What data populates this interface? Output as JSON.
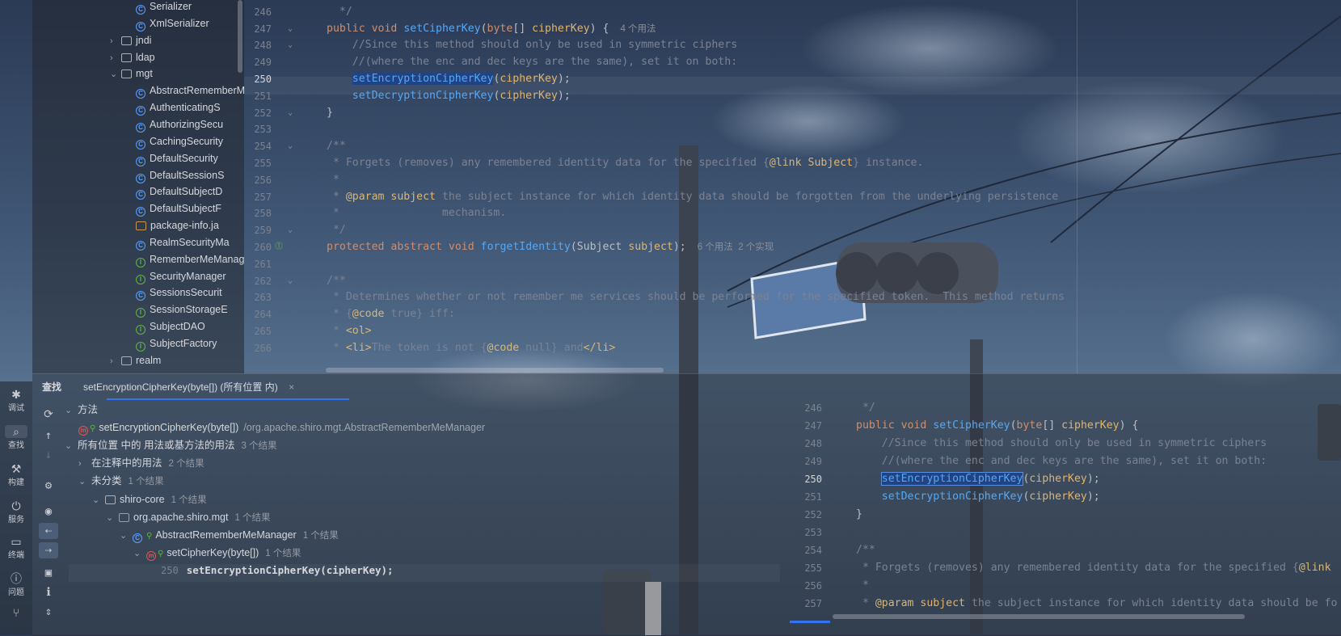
{
  "tree": {
    "items": [
      {
        "label": "Serializer",
        "kind": "class",
        "indent": 3
      },
      {
        "label": "XmlSerializer",
        "kind": "class",
        "indent": 3
      },
      {
        "label": "jndi",
        "kind": "package",
        "indent": 2,
        "chevron": "›"
      },
      {
        "label": "ldap",
        "kind": "package",
        "indent": 2,
        "chevron": "›"
      },
      {
        "label": "mgt",
        "kind": "package",
        "indent": 2,
        "chevron": "⌄"
      },
      {
        "label": "AbstractRememberMe",
        "kind": "class",
        "indent": 3
      },
      {
        "label": "AuthenticatingS",
        "kind": "class",
        "indent": 3
      },
      {
        "label": "AuthorizingSecu",
        "kind": "class",
        "indent": 3
      },
      {
        "label": "CachingSecurity",
        "kind": "class",
        "indent": 3
      },
      {
        "label": "DefaultSecurity",
        "kind": "class",
        "indent": 3
      },
      {
        "label": "DefaultSessionS",
        "kind": "class",
        "indent": 3
      },
      {
        "label": "DefaultSubjectD",
        "kind": "class",
        "indent": 3
      },
      {
        "label": "DefaultSubjectF",
        "kind": "class",
        "indent": 3
      },
      {
        "label": "package-info.ja",
        "kind": "file",
        "indent": 3
      },
      {
        "label": "RealmSecurityMa",
        "kind": "class",
        "indent": 3
      },
      {
        "label": "RememberMeManag",
        "kind": "interface",
        "indent": 3
      },
      {
        "label": "SecurityManager",
        "kind": "interface",
        "indent": 3
      },
      {
        "label": "SessionsSecurit",
        "kind": "class",
        "indent": 3
      },
      {
        "label": "SessionStorageE",
        "kind": "interface",
        "indent": 3
      },
      {
        "label": "SubjectDAO",
        "kind": "interface",
        "indent": 3
      },
      {
        "label": "SubjectFactory",
        "kind": "interface",
        "indent": 3
      },
      {
        "label": "realm",
        "kind": "package",
        "indent": 2,
        "chevron": "›"
      }
    ]
  },
  "editor": {
    "current_line": "250",
    "lines": [
      {
        "n": "",
        "text": "  */"
      },
      {
        "n": "246",
        "text": "  */"
      },
      {
        "n": "247",
        "text": "public void setCipherKey(byte[] cipherKey) {",
        "hint": "4 个用法"
      },
      {
        "n": "248",
        "text": "    //Since this method should only be used in symmetric ciphers"
      },
      {
        "n": "249",
        "text": "    //(where the enc and dec keys are the same), set it on both:"
      },
      {
        "n": "250",
        "text": "    setEncryptionCipherKey(cipherKey);"
      },
      {
        "n": "251",
        "text": "    setDecryptionCipherKey(cipherKey);"
      },
      {
        "n": "252",
        "text": "}"
      },
      {
        "n": "253",
        "text": ""
      },
      {
        "n": "254",
        "text": "/**"
      },
      {
        "n": "255",
        "text": " * Forgets (removes) any remembered identity data for the specified {@link Subject} instance."
      },
      {
        "n": "256",
        "text": " *"
      },
      {
        "n": "257",
        "text": " * @param subject the subject instance for which identity data should be forgotten from the underlying persistence"
      },
      {
        "n": "258",
        "text": " *                mechanism."
      },
      {
        "n": "259",
        "text": " */"
      },
      {
        "n": "260",
        "text": "protected abstract void forgetIdentity(Subject subject);",
        "hint": "6 个用法  2 个实现"
      },
      {
        "n": "261",
        "text": ""
      },
      {
        "n": "262",
        "text": "/**"
      },
      {
        "n": "263",
        "text": " * Determines whether or not remember me services should be performed for the specified token.  This method returns"
      },
      {
        "n": "264",
        "text": " * {@code true} iff:"
      },
      {
        "n": "265",
        "text": " * <ol>"
      },
      {
        "n": "266",
        "text": " * <li>The token is not {@code null} and</li>"
      }
    ]
  },
  "sidebar": {
    "items": [
      {
        "label": "调试",
        "icon": "debug-icon",
        "glyph": "✱"
      },
      {
        "label": "查找",
        "icon": "find-icon",
        "glyph": "⌕",
        "active": true
      },
      {
        "label": "构建",
        "icon": "build-icon",
        "glyph": "⚒"
      },
      {
        "label": "服务",
        "icon": "services-icon",
        "glyph": "⏻"
      },
      {
        "label": "终端",
        "icon": "terminal-icon",
        "glyph": "▭"
      },
      {
        "label": "问题",
        "icon": "problems-icon",
        "glyph": "ⓘ"
      },
      {
        "label": "",
        "icon": "git-icon",
        "glyph": "⑂"
      }
    ]
  },
  "find_panel": {
    "title": "查找",
    "tab_label": "setEncryptionCipherKey(byte[]) (所有位置 内)",
    "close": "×",
    "tree": [
      {
        "label": "方法",
        "indent": 0,
        "chevron": "⌄"
      },
      {
        "label": "setEncryptionCipherKey(byte[])",
        "suffix": "/org.apache.shiro.mgt.AbstractRememberMeManager",
        "indent": 1,
        "icon": "method"
      },
      {
        "label": "所有位置 中的 用法或基方法的用法",
        "count": "3 个结果",
        "indent": 0,
        "chevron": "⌄"
      },
      {
        "label": "在注释中的用法",
        "count": "2 个结果",
        "indent": 1,
        "chevron": "›"
      },
      {
        "label": "未分类",
        "count": "1 个结果",
        "indent": 1,
        "chevron": "⌄"
      },
      {
        "label": "shiro-core",
        "count": "1 个结果",
        "indent": 2,
        "chevron": "⌄",
        "icon": "module"
      },
      {
        "label": "org.apache.shiro.mgt",
        "count": "1 个结果",
        "indent": 3,
        "chevron": "⌄",
        "icon": "package"
      },
      {
        "label": "AbstractRememberMeManager",
        "count": "1 个结果",
        "indent": 4,
        "chevron": "⌄",
        "icon": "class"
      },
      {
        "label": "setCipherKey(byte[])",
        "count": "1 个结果",
        "indent": 5,
        "chevron": "⌄",
        "icon": "method"
      },
      {
        "label": "setEncryptionCipherKey(cipherKey);",
        "line": "250",
        "indent": 7
      }
    ]
  },
  "preview": {
    "lines": [
      {
        "n": "246",
        "text": " */"
      },
      {
        "n": "247",
        "text": "public void setCipherKey(byte[] cipherKey) {"
      },
      {
        "n": "248",
        "text": "    //Since this method should only be used in symmetric ciphers"
      },
      {
        "n": "249",
        "text": "    //(where the enc and dec keys are the same), set it on both:"
      },
      {
        "n": "250",
        "text": "    setEncryptionCipherKey(cipherKey);"
      },
      {
        "n": "251",
        "text": "    setDecryptionCipherKey(cipherKey);"
      },
      {
        "n": "252",
        "text": "}"
      },
      {
        "n": "253",
        "text": ""
      },
      {
        "n": "254",
        "text": "/**"
      },
      {
        "n": "255",
        "text": " * Forgets (removes) any remembered identity data for the specified {@link"
      },
      {
        "n": "256",
        "text": " *"
      },
      {
        "n": "257",
        "text": " * @param subject the subject instance for which identity data should be fo"
      }
    ]
  },
  "colors": {
    "accent": "#3574f0",
    "keyword": "#cf8e6d",
    "function": "#56a8f5",
    "param": "#e0b46c",
    "comment": "#7a8294",
    "selection": "#214283"
  }
}
